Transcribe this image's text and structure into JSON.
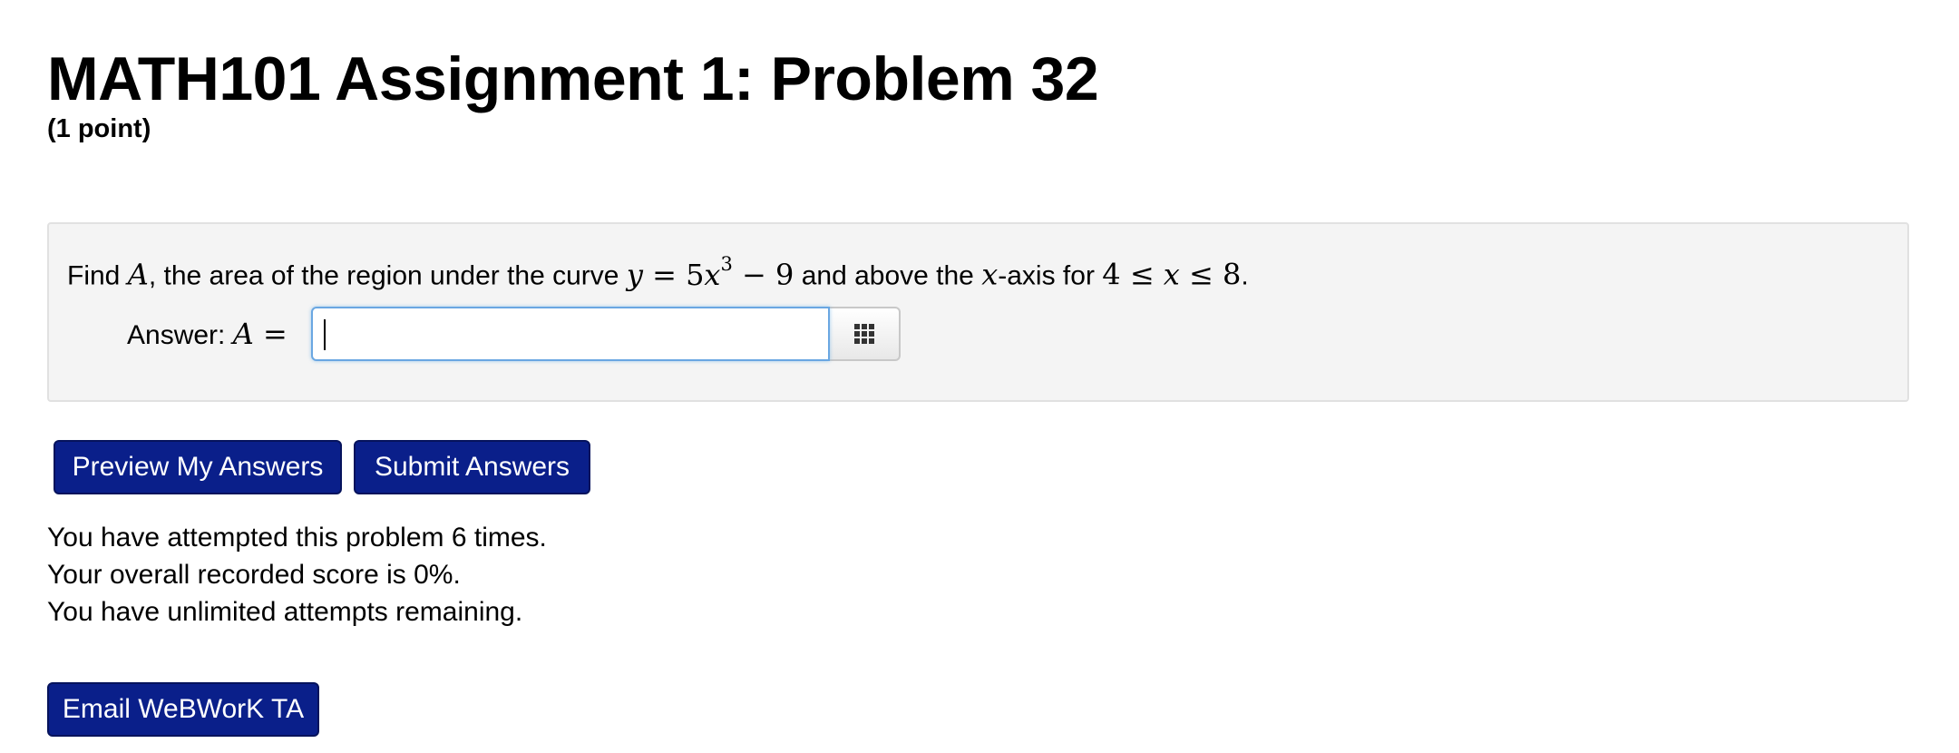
{
  "header": {
    "title": "MATH101 Assignment 1: Problem 32",
    "points": "(1 point)"
  },
  "problem": {
    "text_find": "Find ",
    "var_A": "A",
    "text_area": ", the area of the region under the curve ",
    "curve_lhs": "y",
    "curve_eq": " = 5",
    "curve_x": "x",
    "curve_exp": "3",
    "curve_tail": " − 9",
    "text_above": " and above the ",
    "axis_var": "x",
    "text_axis": "-axis for ",
    "bound_low": "4 ≤ ",
    "bound_x": "x",
    "bound_high": " ≤ 8",
    "period": "."
  },
  "answer": {
    "label": "Answer: ",
    "var": "A",
    "equals": " =",
    "value": "",
    "placeholder": "",
    "grid_icon": "grid-icon"
  },
  "buttons": {
    "preview": "Preview My Answers",
    "submit": "Submit Answers",
    "email": "Email WeBWorK TA"
  },
  "status": {
    "attempts": "You have attempted this problem 6 times.",
    "score": "Your overall recorded score is 0%.",
    "remaining": "You have unlimited attempts remaining."
  },
  "colors": {
    "button_bg": "#0a1f8a",
    "box_bg": "#f4f4f4",
    "input_focus": "#6aa7e2"
  }
}
